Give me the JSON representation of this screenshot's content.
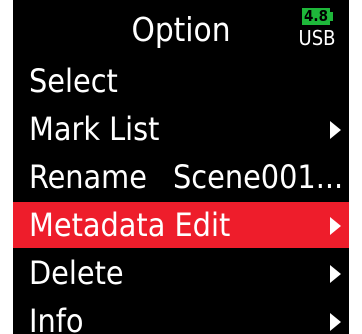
{
  "header": {
    "title": "Option",
    "battery_level": "4.8",
    "power_source": "USB"
  },
  "colors": {
    "screen_background": "#000000",
    "selected_row": "#ee1d2b",
    "battery_fill": "#1eb83a"
  },
  "menu": {
    "items": [
      {
        "label": "Select",
        "value": "",
        "arrow": false,
        "selected": false
      },
      {
        "label": "Mark List",
        "value": "",
        "arrow": true,
        "arrow_icon": "triangle-right-icon",
        "selected": false
      },
      {
        "label": "Rename",
        "value": "Scene001...",
        "arrow": false,
        "selected": false
      },
      {
        "label": "Metadata Edit",
        "value": "",
        "arrow": true,
        "arrow_icon": "triangle-right-icon",
        "selected": true
      },
      {
        "label": "Delete",
        "value": "",
        "arrow": true,
        "arrow_icon": "triangle-right-icon",
        "selected": false
      },
      {
        "label": "Info",
        "value": "",
        "arrow": true,
        "arrow_icon": "triangle-right-icon",
        "selected": false
      }
    ]
  }
}
